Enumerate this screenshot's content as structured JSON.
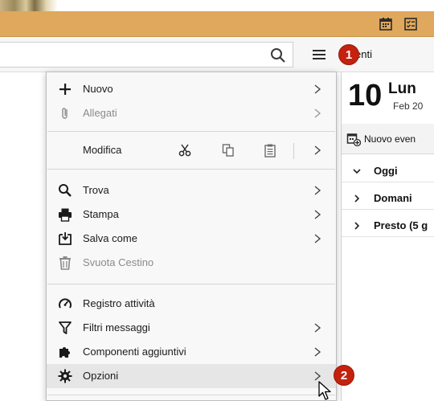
{
  "titlebar": {
    "color": "#dfa85c",
    "icons": [
      "calendar-icon",
      "tasks-icon"
    ]
  },
  "toolbar": {
    "search": {
      "value": "",
      "placeholder": ""
    },
    "tab_label": "enti"
  },
  "badges": {
    "first": "1",
    "second": "2"
  },
  "menu": {
    "items": [
      {
        "label": "Nuovo",
        "icon": "plus-icon",
        "submenu": true,
        "enabled": true
      },
      {
        "label": "Allegati",
        "icon": "paperclip-icon",
        "submenu": true,
        "enabled": false
      },
      {
        "label": "Modifica",
        "submenu": true,
        "enabled": true,
        "actions": [
          "cut-icon",
          "copy-icon",
          "paste-icon"
        ]
      },
      {
        "label": "Trova",
        "icon": "search-icon",
        "submenu": true,
        "enabled": true
      },
      {
        "label": "Stampa",
        "icon": "printer-icon",
        "submenu": true,
        "enabled": true
      },
      {
        "label": "Salva come",
        "icon": "save-as-icon",
        "submenu": true,
        "enabled": true
      },
      {
        "label": "Svuota Cestino",
        "icon": "trash-icon",
        "submenu": false,
        "enabled": false
      },
      {
        "label": "Registro attività",
        "icon": "gauge-icon",
        "submenu": false,
        "enabled": true
      },
      {
        "label": "Filtri messaggi",
        "icon": "filter-icon",
        "submenu": true,
        "enabled": true
      },
      {
        "label": "Componenti aggiuntivi",
        "icon": "puzzle-icon",
        "submenu": true,
        "enabled": true
      },
      {
        "label": "Opzioni",
        "icon": "gear-icon",
        "submenu": true,
        "enabled": true,
        "hovered": true
      }
    ]
  },
  "calendar": {
    "day_number": "10",
    "day_name": "Lun",
    "month": "Feb 20",
    "new_event_label": "Nuovo even",
    "agenda": [
      {
        "label": "Oggi",
        "expanded": true
      },
      {
        "label": "Domani",
        "expanded": false
      },
      {
        "label": "Presto (5 g",
        "expanded": false
      }
    ]
  }
}
